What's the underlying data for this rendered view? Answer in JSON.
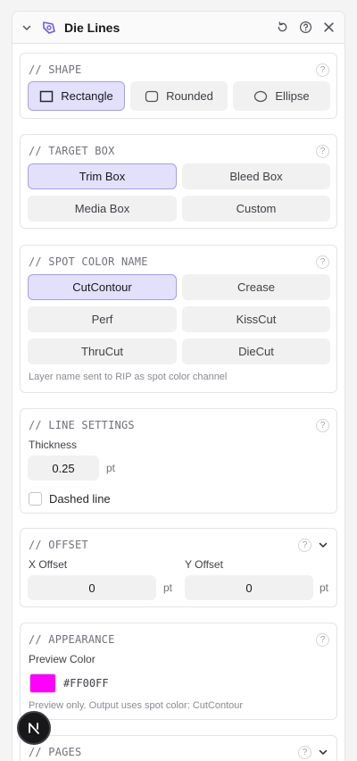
{
  "panel": {
    "title": "Die Lines",
    "icons": {
      "collapse": "chevron-down-icon",
      "logo": "die-line-logo-icon",
      "reset": "reset-icon",
      "help": "help-icon",
      "close": "close-icon"
    }
  },
  "shape": {
    "title": "// SHAPE",
    "help": "?",
    "options": [
      {
        "label": "Rectangle",
        "icon": "rectangle-icon",
        "selected": true
      },
      {
        "label": "Rounded",
        "icon": "rounded-rectangle-icon",
        "selected": false
      },
      {
        "label": "Ellipse",
        "icon": "ellipse-icon",
        "selected": false
      }
    ]
  },
  "target_box": {
    "title": "// TARGET BOX",
    "help": "?",
    "options": [
      {
        "label": "Trim Box",
        "selected": true
      },
      {
        "label": "Bleed Box",
        "selected": false
      },
      {
        "label": "Media Box",
        "selected": false
      },
      {
        "label": "Custom",
        "selected": false
      }
    ]
  },
  "spot_color": {
    "title": "// SPOT COLOR NAME",
    "help": "?",
    "options": [
      {
        "label": "CutContour",
        "selected": true
      },
      {
        "label": "Crease",
        "selected": false
      },
      {
        "label": "Perf",
        "selected": false
      },
      {
        "label": "KissCut",
        "selected": false
      },
      {
        "label": "ThruCut",
        "selected": false
      },
      {
        "label": "DieCut",
        "selected": false
      }
    ],
    "hint": "Layer name sent to RIP as spot color channel"
  },
  "line_settings": {
    "title": "// LINE SETTINGS",
    "help": "?",
    "thickness_label": "Thickness",
    "thickness_value": "0.25",
    "thickness_unit": "pt",
    "dashed_label": "Dashed line",
    "dashed_checked": false
  },
  "offset": {
    "title": "// OFFSET",
    "help": "?",
    "x_label": "X Offset",
    "x_value": "0",
    "x_unit": "pt",
    "y_label": "Y Offset",
    "y_value": "0",
    "y_unit": "pt"
  },
  "appearance": {
    "title": "// APPEARANCE",
    "help": "?",
    "preview_label": "Preview Color",
    "color": "#FF00FF",
    "color_hex_label": "#FF00FF",
    "hint": "Preview only. Output uses spot color: CutContour"
  },
  "pages": {
    "title": "// PAGES",
    "help": "?"
  },
  "fab": {
    "label": "N",
    "icon": "next-logo-icon"
  },
  "colors": {
    "accent_bg": "#e3e0fb",
    "accent_border": "#a79cf0",
    "logo": "#6d5ce8"
  }
}
